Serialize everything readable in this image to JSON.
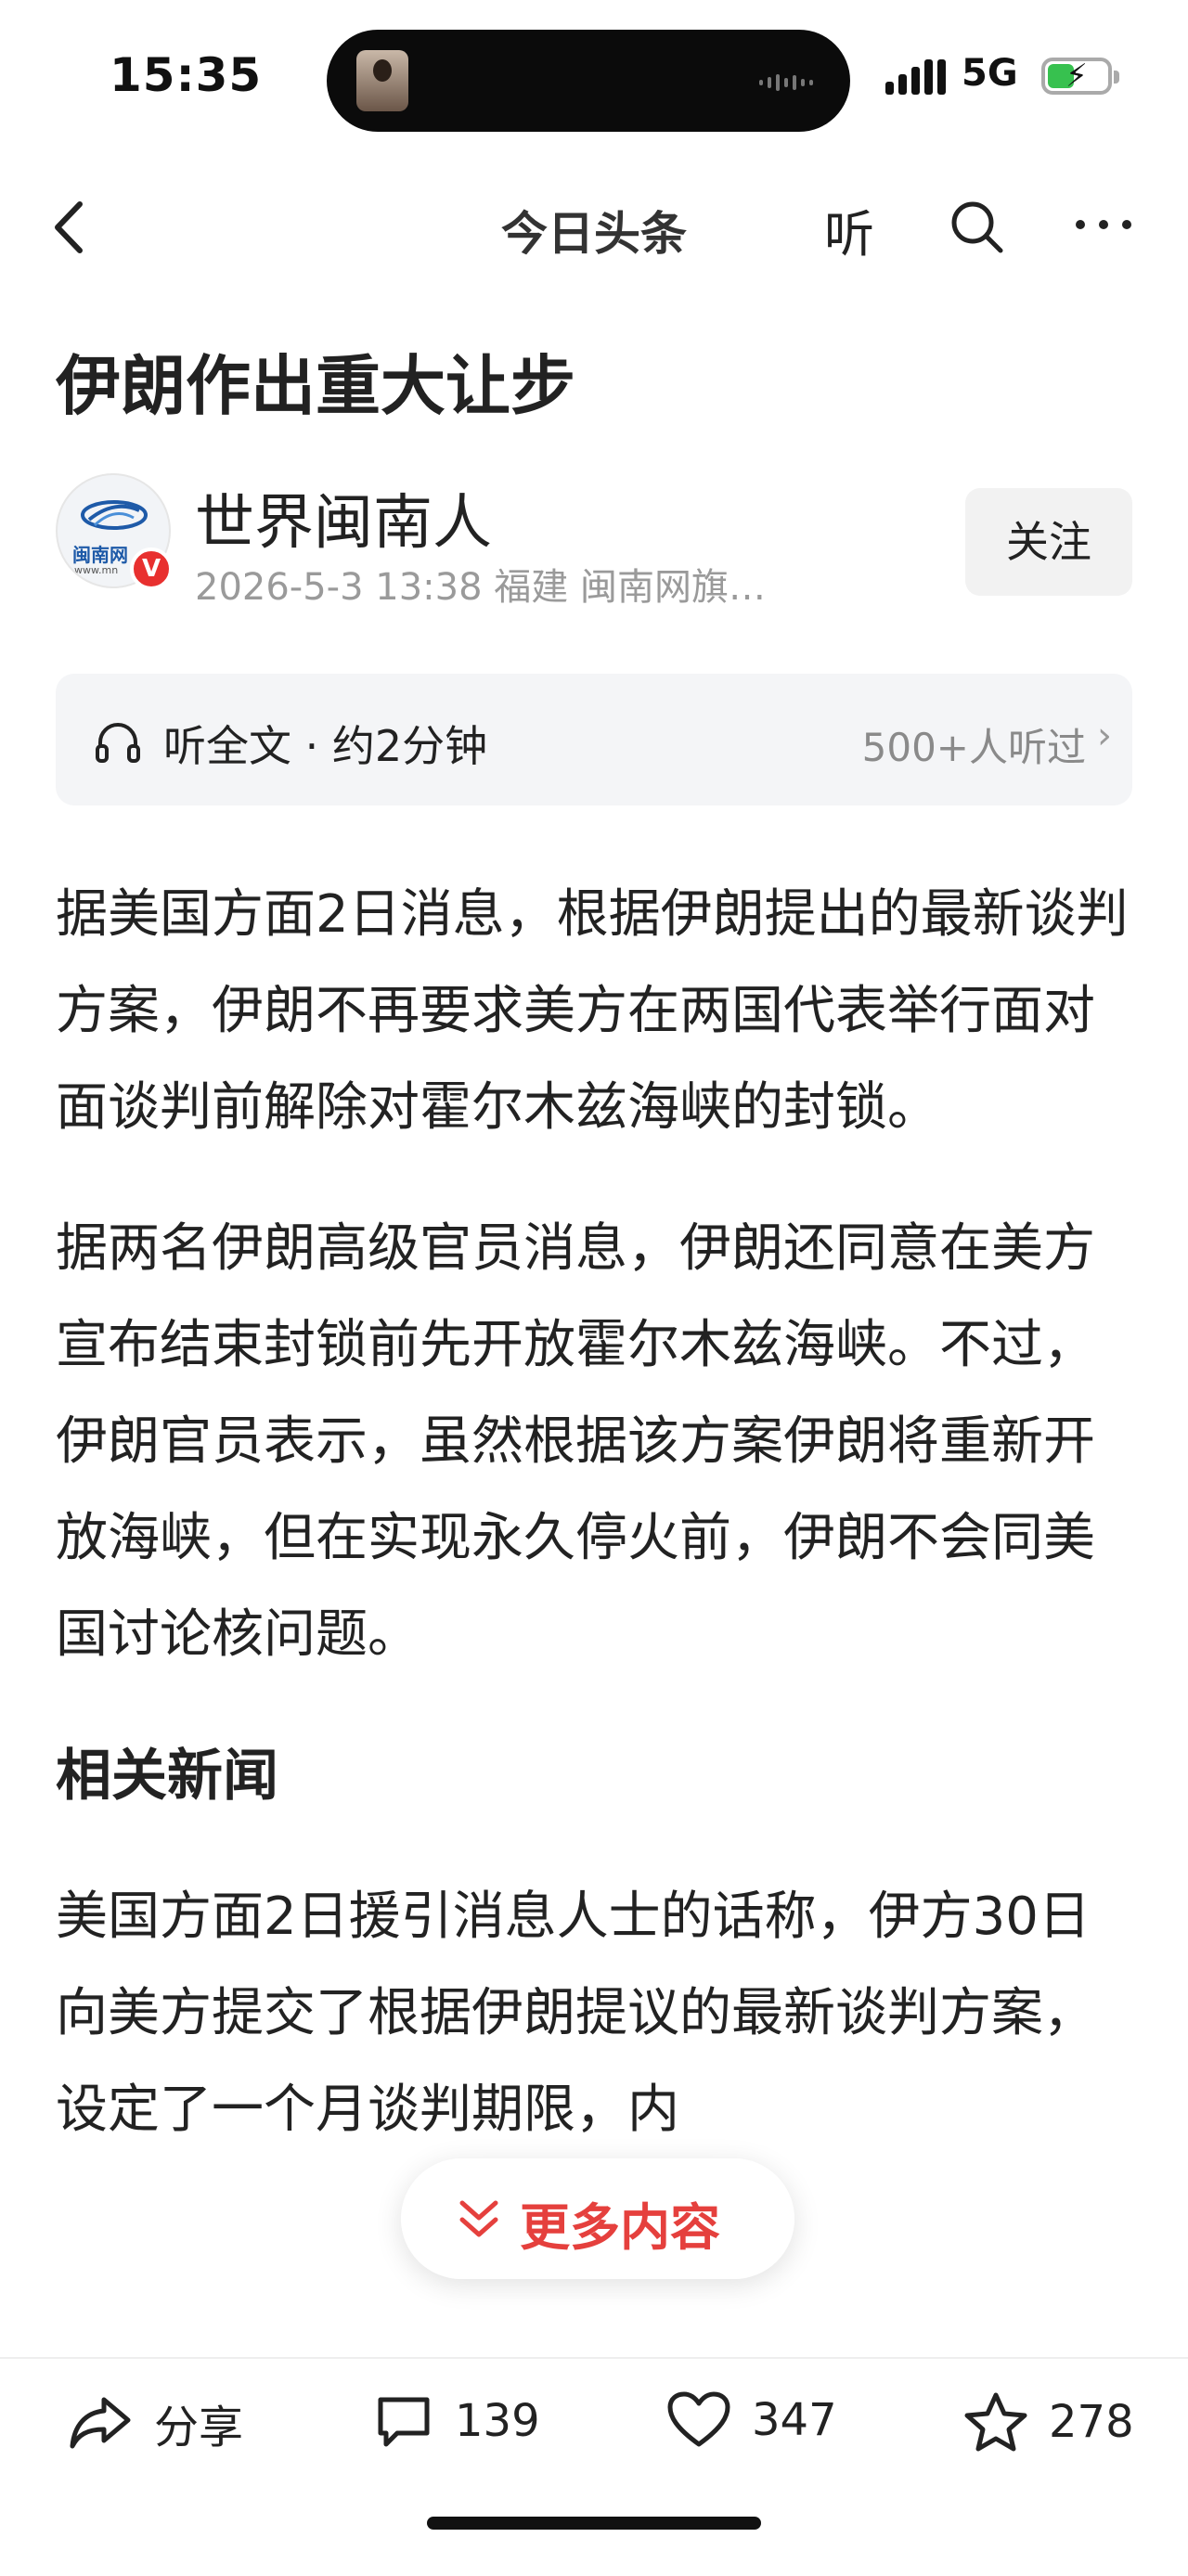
{
  "status_bar": {
    "time": "15:35",
    "network": "5G"
  },
  "nav": {
    "title": "今日头条",
    "listen_label": "听"
  },
  "article": {
    "title": "伊朗作出重大让步",
    "author": {
      "name": "世界闽南人",
      "meta": "2026-5-3 13:38 福建 闽南网旗…",
      "avatar_caption": "闽南网",
      "avatar_url_text": "www.mn",
      "verified_badge": "V",
      "follow_label": "关注"
    },
    "audio": {
      "label": "听全文 · 约2分钟",
      "listeners": "500+人听过"
    },
    "paragraphs": [
      "据美国方面2日消息，根据伊朗提出的最新谈判方案，伊朗不再要求美方在两国代表举行面对面谈判前解除对霍尔木兹海峡的封锁。",
      "据两名伊朗高级官员消息，伊朗还同意在美方宣布结束封锁前先开放霍尔木兹海峡。不过，伊朗官员表示，虽然根据该方案伊朗将重新开放海峡，但在实现永久停火前，伊朗不会同美国讨论核问题。"
    ],
    "section_heading": "相关新闻",
    "related_paragraph": "美国方面2日援引消息人士的话称，伊方30日向美方提交了根据伊朗提议的最新谈判方案，设定了一个月谈判期限，内"
  },
  "more_content_label": "更多内容",
  "bottom_bar": {
    "share_label": "分享",
    "comments": "139",
    "likes": "347",
    "favorites": "278"
  },
  "colors": {
    "accent": "#e5403d",
    "verified": "#e8302f",
    "battery": "#37c14f"
  }
}
